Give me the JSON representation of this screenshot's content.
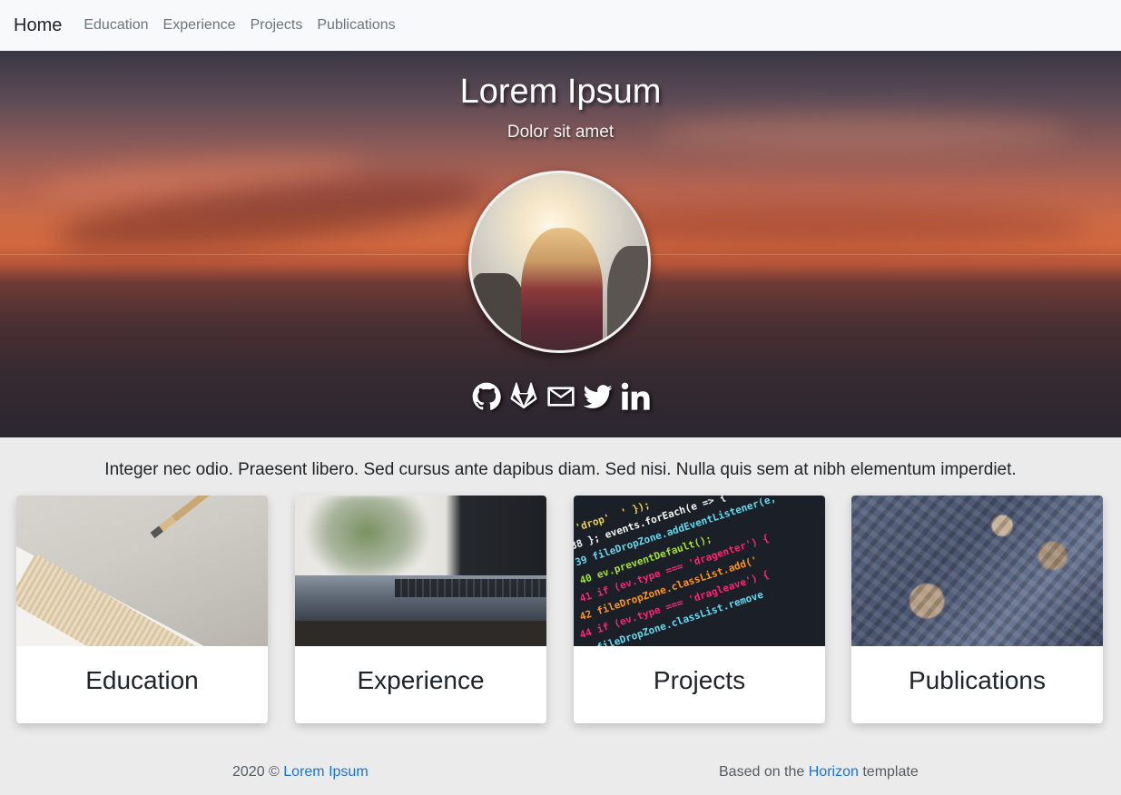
{
  "navbar": {
    "brand": "Home",
    "links": [
      "Education",
      "Experience",
      "Projects",
      "Publications"
    ]
  },
  "hero": {
    "title": "Lorem Ipsum",
    "subtitle": "Dolor sit amet",
    "avatar_icon": "profile-photo",
    "social_icons": [
      "github-icon",
      "gitlab-icon",
      "envelope-icon",
      "twitter-icon",
      "linkedin-icon"
    ]
  },
  "intro": "Integer nec odio. Praesent libero. Sed cursus ante dapibus diam. Sed nisi. Nulla quis sem at nibh elementum imperdiet.",
  "cards": [
    {
      "title": "Education"
    },
    {
      "title": "Experience"
    },
    {
      "title": "Projects"
    },
    {
      "title": "Publications"
    }
  ],
  "footer": {
    "year_text": "2020 ©",
    "author_link": "Lorem Ipsum",
    "based_on": "Based on the",
    "template_link": "Horizon",
    "template_suffix": "template"
  },
  "colors": {
    "link": "#1a73d9",
    "navbar_bg": "#f8f9fa",
    "page_bg": "#ebebeb"
  }
}
